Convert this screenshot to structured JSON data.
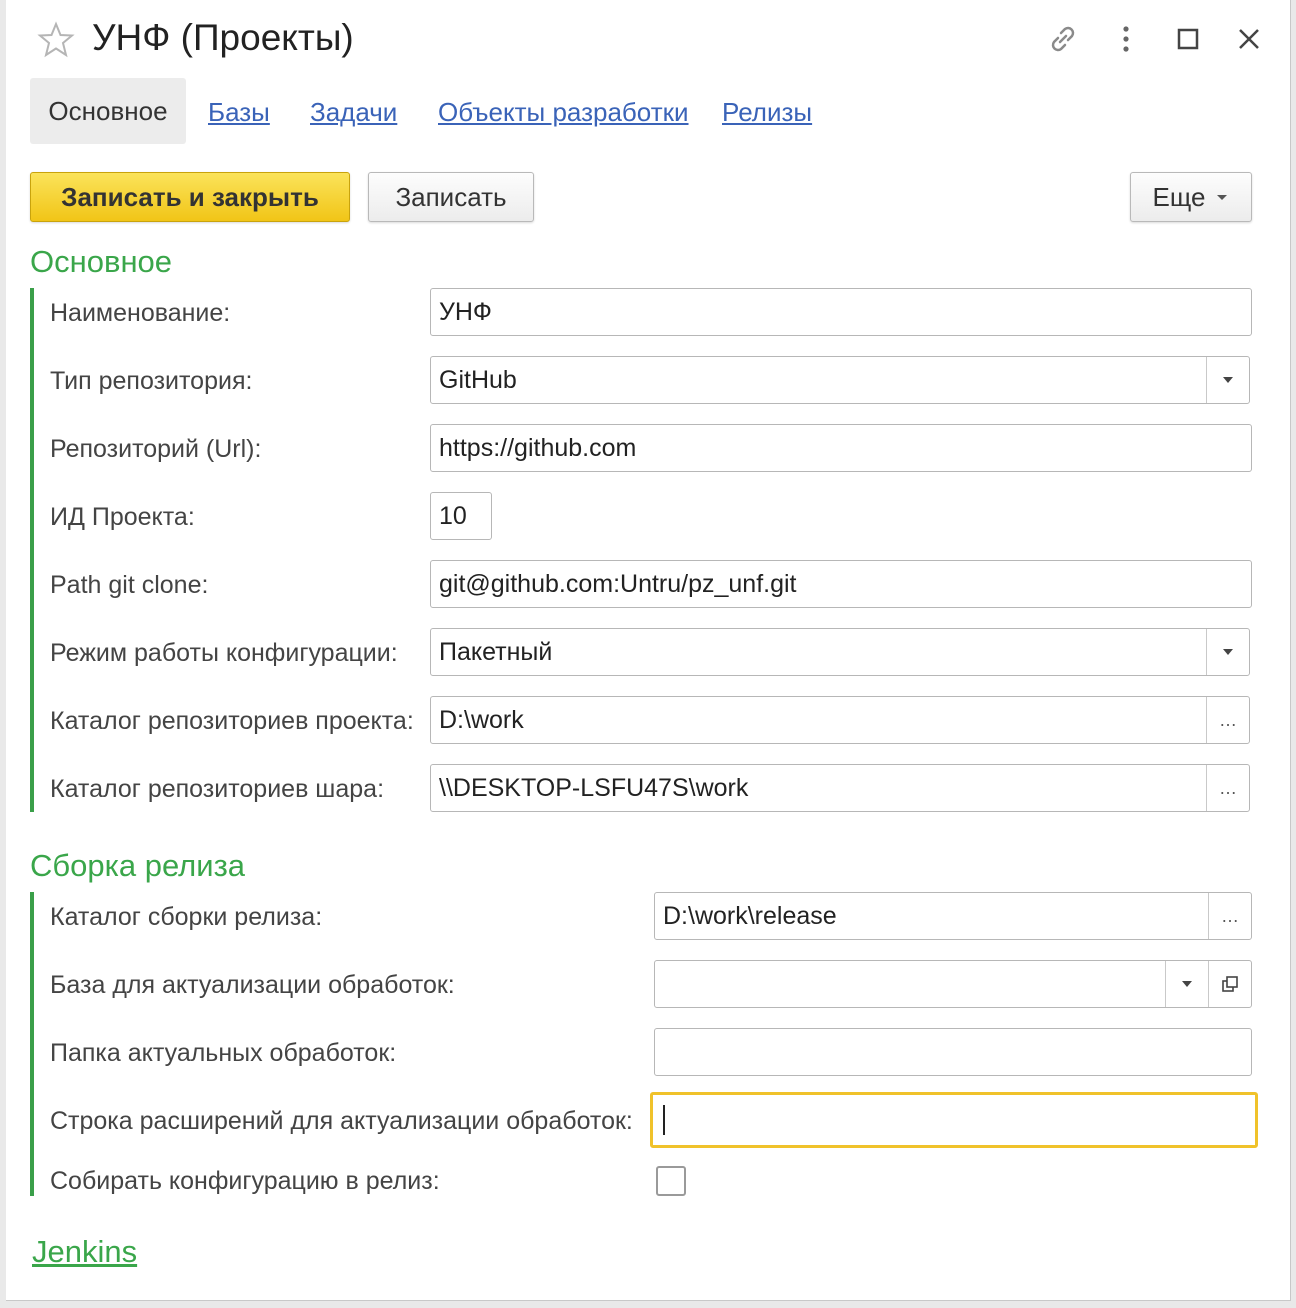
{
  "window": {
    "title": "УНФ (Проекты)"
  },
  "tabs": {
    "active": "Основное",
    "links": [
      "Базы",
      "Задачи",
      "Объекты разработки",
      "Релизы"
    ]
  },
  "toolbar": {
    "save_close_label": "Записать и закрыть",
    "save_label": "Записать",
    "more_label": "Еще"
  },
  "section_main": {
    "title": "Основное",
    "name_label": "Наименование:",
    "name_value": "УНФ",
    "repo_type_label": "Тип репозитория:",
    "repo_type_value": "GitHub",
    "repo_url_label": "Репозиторий (Url):",
    "repo_url_value": "https://github.com",
    "project_id_label": "ИД Проекта:",
    "project_id_value": "10",
    "git_clone_label": "Path git clone:",
    "git_clone_value": "git@github.com:Untru/pz_unf.git",
    "config_mode_label": "Режим работы конфигурации:",
    "config_mode_value": "Пакетный",
    "project_repo_dir_label": "Каталог репозиториев проекта:",
    "project_repo_dir_value": "D:\\work",
    "share_repo_dir_label": "Каталог репозиториев шара:",
    "share_repo_dir_value": "\\\\DESKTOP-LSFU47S\\work"
  },
  "section_release": {
    "title": "Сборка релиза",
    "build_dir_label": "Каталог сборки релиза:",
    "build_dir_value": "D:\\work\\release",
    "update_base_label": "База для актуализации обработок:",
    "update_base_value": "",
    "actual_folder_label": "Папка актуальных обработок:",
    "actual_folder_value": "",
    "ext_string_label": "Строка расширений для актуализации обработок:",
    "ext_string_value": "",
    "build_config_label": "Собирать конфигурацию в релиз:",
    "build_config_checked": false
  },
  "jenkins_label": "Jenkins",
  "colors": {
    "accent_green": "#3aa64a",
    "primary_button": "#f1c517",
    "link_blue": "#3a63b8",
    "focus_border": "#f0c22a"
  }
}
